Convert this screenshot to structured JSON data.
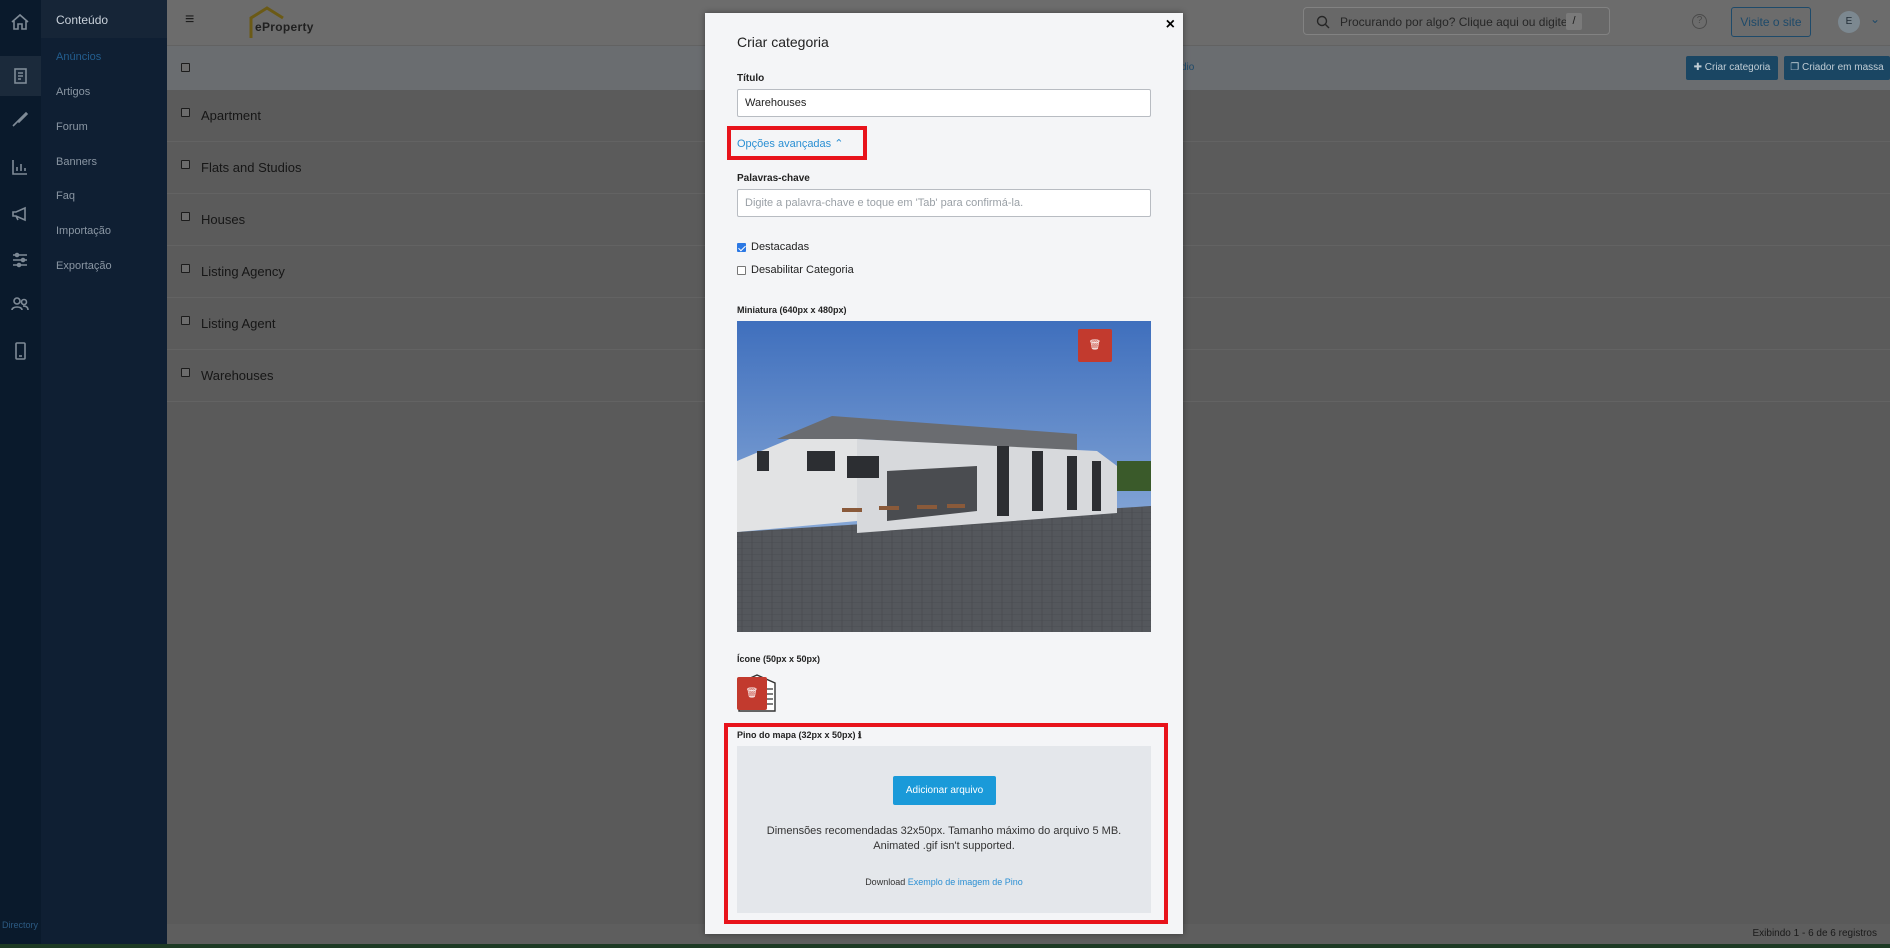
{
  "nav": {
    "header": "Conteúdo",
    "items": [
      "Anúncios",
      "Artigos",
      "Forum",
      "Banners",
      "Faq",
      "Importação",
      "Exportação"
    ],
    "footer": "Directory"
  },
  "topbar": {
    "logo_text": "eProperty",
    "search_placeholder": "Procurando por algo? Clique aqui ou digite",
    "search_shortcut": "/",
    "help_icon": "?",
    "visit_label": "Visite o site",
    "avatar_initial": "E"
  },
  "toolbar": {
    "header_link": "dio",
    "create_label": "✚ Criar categoria",
    "bulk_label": "❐ Criador em massa"
  },
  "list": {
    "rows": [
      "Apartment",
      "Flats and Studios",
      "Houses",
      "Listing Agency",
      "Listing Agent",
      "Warehouses"
    ]
  },
  "footer": {
    "count": "Exibindo 1 - 6 de 6 registros"
  },
  "modal": {
    "close": "×",
    "title": "Criar categoria",
    "title_label": "Título",
    "title_value": "Warehouses",
    "advanced_label": "Opções avançadas ⌃",
    "keywords_label": "Palavras-chave",
    "keywords_placeholder": "Digite a palavra-chave e toque em 'Tab' para confirmá-la.",
    "featured_label": "Destacadas",
    "featured_checked": true,
    "disable_label": "Desabilitar Categoria",
    "disable_checked": false,
    "thumbnail_label": "Miniatura (640px x 480px)",
    "icon_label": "Ícone (50px x 50px)",
    "pin_label": "Pino do mapa (32px x 50px) ℹ",
    "upload_button": "Adicionar arquivo",
    "dz_line1": "Dimensões recomendadas 32x50px. Tamanho máximo do arquivo 5 MB.",
    "dz_line2": "Animated .gif isn't supported.",
    "download_prefix": "Download",
    "download_link": "Exemplo de imagem de Pino",
    "delete_icon": "🗑"
  },
  "colors": {
    "accent": "#2a8fd3",
    "highlight": "#e8131b",
    "delete": "#c23a2e",
    "upload": "#1a9ad9"
  }
}
